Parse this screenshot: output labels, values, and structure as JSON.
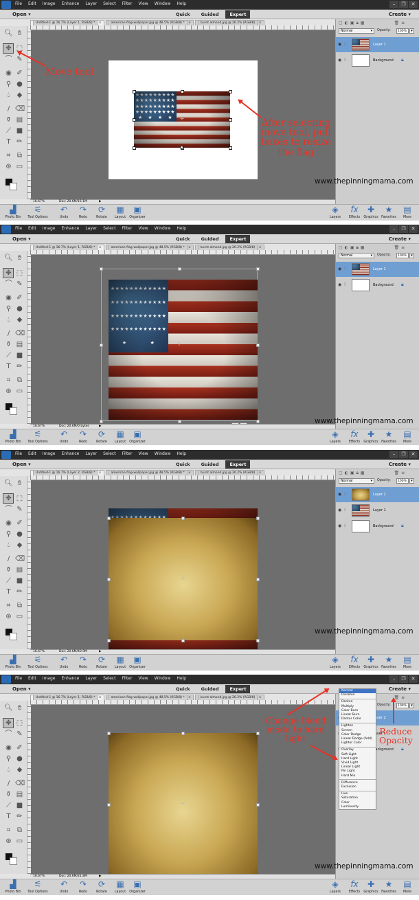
{
  "app": {
    "menu": [
      "File",
      "Edit",
      "Image",
      "Enhance",
      "Layer",
      "Select",
      "Filter",
      "View",
      "Window",
      "Help"
    ],
    "open_label": "Open",
    "modes": [
      "Quick",
      "Guided",
      "Expert"
    ],
    "active_mode": "Expert",
    "create_label": "Create",
    "doc_tabs": [
      "Untitled-1 @ 16.7% (Layer 1, RGB/8) *",
      "american-flag-wallpaper.jpg @ 48.5% (RGB/8) *",
      "burnt almond.jpg @ 26.2% (RGB/8)"
    ],
    "doc_tabs_panel3": [
      "Untitled-1 @ 16.7% (Layer 2, RGB/8) *",
      "american-flag-wallpaper.jpg @ 48.5% (RGB/8) *",
      "burnt almond.jpg @ 26.2% (RGB/8)"
    ],
    "zoom": "16.67%",
    "doc_sizes": [
      "Doc: 20.6M/16.1M",
      "Doc: 20.6M/0 bytes",
      "Doc: 20.6M/40.9M",
      "Doc: 20.6M/21.8M"
    ],
    "bottom_left": [
      "Photo Bin",
      "Tool Options",
      "Undo",
      "Redo",
      "Rotate",
      "Layout",
      "Organizer"
    ],
    "bottom_right": [
      "Layers",
      "Effects",
      "Graphics",
      "Favorites",
      "More"
    ],
    "blend_mode": "Normal",
    "opacity_label": "Opacity:",
    "opacity_value": "100%",
    "watermark": "www.thepinningmama.com"
  },
  "layers": {
    "panel1": [
      "Layer 1",
      "Background"
    ],
    "panel2": [
      "Layer 1",
      "Background"
    ],
    "panel3": [
      "Layer 2",
      "Layer 1",
      "Background"
    ]
  },
  "blend_menu": [
    [
      "Normal",
      "Dissolve"
    ],
    [
      "Darken",
      "Multiply",
      "Color Burn",
      "Linear Burn",
      "Darker Color"
    ],
    [
      "Lighten",
      "Screen",
      "Color Dodge",
      "Linear Dodge (Add)",
      "Lighter Color"
    ],
    [
      "Overlay",
      "Soft Light",
      "Hard Light",
      "Vivid Light",
      "Linear Light",
      "Pin Light",
      "Hard Mix"
    ],
    [
      "Difference",
      "Exclusion"
    ],
    [
      "Hue",
      "Saturation",
      "Color",
      "Luminosity"
    ]
  ],
  "annotations": {
    "move_tool": "Move tool",
    "resize": "After selecting move tool, pull boxes to resize the flag",
    "blend": "Change blend mode to hard light",
    "opacity": "Reduce Opacity"
  },
  "colors": {
    "annotation": "#e83225",
    "selected_layer": "#6f9ed2",
    "menu_highlight": "#3e74c6"
  }
}
